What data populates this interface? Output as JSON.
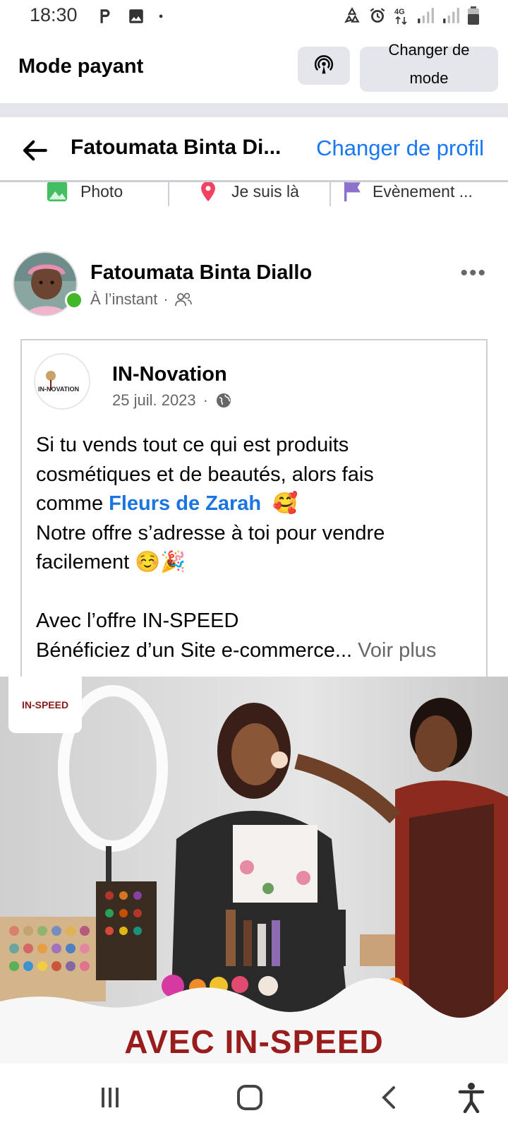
{
  "status_bar": {
    "time": "18:30",
    "left_icons": [
      "parking-icon",
      "gallery-icon",
      "dot-icon"
    ],
    "right_icons": [
      "recycle-icon",
      "alarm-icon",
      "4g-icon",
      "signal-icon",
      "signal-icon",
      "battery-icon"
    ],
    "network": "4G"
  },
  "header": {
    "title": "Mode payant",
    "change_mode_line1": "Changer de",
    "change_mode_line2": "mode"
  },
  "profile_bar": {
    "name": "Fatoumata Binta Di...",
    "change_profile": "Changer de profil"
  },
  "chips": [
    {
      "label": "Photo",
      "icon": "photo-icon"
    },
    {
      "label": "Je suis là",
      "icon": "location-pin-icon"
    },
    {
      "label": "Evènement ...",
      "icon": "flag-icon"
    }
  ],
  "post": {
    "author": "Fatoumata Binta Diallo",
    "time": "À l’instant",
    "separator": "·",
    "more": "•••"
  },
  "shared": {
    "page_name": "IN-Novation",
    "date": "25 juil. 2023",
    "separator": "·",
    "logo_text": "IN-NOVATION",
    "text_line1": "Si tu vends tout ce qui est produits",
    "text_line2": "cosmétiques et de beautés, alors fais",
    "text_line3_prefix": "comme ",
    "mention": "Fleurs de Zarah",
    "emoji_love": "🥰",
    "text_line4": "Notre offre s’adresse à toi pour vendre",
    "text_line5": "facilement ",
    "emoji_line5": "☺️🎉",
    "text_line7": "Avec l’offre IN-SPEED",
    "text_line8": "Bénéficiez d’un Site e-commerce...",
    "see_more": "Voir plus"
  },
  "ad_image": {
    "logo_text": "IN-SPEED",
    "banner": "AVEC IN-SPEED"
  },
  "colors": {
    "accent": "#1877f2",
    "mention": "#1b74e4",
    "online": "#42b72a",
    "banner": "#9a1d1d"
  }
}
